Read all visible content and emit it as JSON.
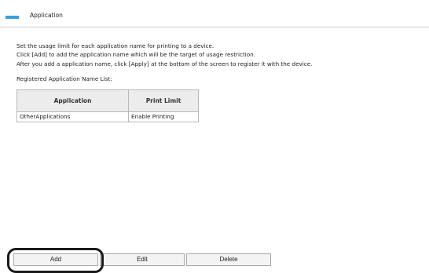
{
  "section": {
    "title": "Application",
    "marker_color": "#3aa0dd"
  },
  "description": {
    "line1": "Set the usage limit for each application name for printing to a device.",
    "line2": "Click [Add] to add the application name which will be the target of usage restriction.",
    "line3": "After you add a application name, click [Apply] at the bottom of the screen to register it with the device."
  },
  "list": {
    "label": "Registered Application Name List:",
    "columns": [
      "Application",
      "Print Limit"
    ],
    "rows": [
      {
        "application": "OtherApplications",
        "print_limit": "Enable Printing"
      }
    ]
  },
  "buttons": {
    "add": "Add",
    "edit": "Edit",
    "delete": "Delete"
  }
}
